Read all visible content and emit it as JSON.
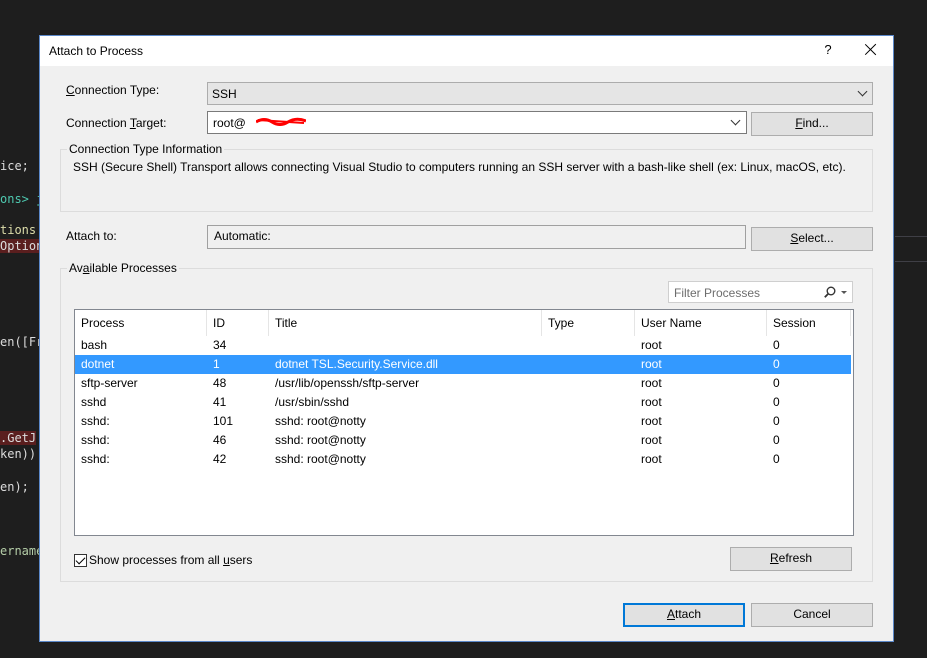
{
  "background": {
    "code_lines": [
      "ice;",
      "ons> j",
      "tions",
      "Option",
      "en([Fr",
      ".GetJ",
      "ken))",
      "en);",
      "ername"
    ]
  },
  "dialog": {
    "title": "Attach to Process",
    "help_label": "?",
    "connection_type": {
      "label_pre": "",
      "label_key": "C",
      "label_post": "onnection Type:",
      "value": "SSH"
    },
    "connection_target": {
      "label_pre": "Connection ",
      "label_key": "T",
      "label_post": "arget:",
      "value": "root@"
    },
    "find_button": {
      "key": "F",
      "rest": "ind..."
    },
    "info": {
      "caption": "Connection Type Information",
      "text": "SSH (Secure Shell) Transport allows connecting Visual Studio to computers running an SSH server with a bash-like shell (ex: Linux, macOS, etc)."
    },
    "attach_to": {
      "label": "Attach to:",
      "value": "Automatic:"
    },
    "select_button": {
      "key": "S",
      "rest": "elect..."
    },
    "available_processes": {
      "caption_pre": "Av",
      "caption_key": "a",
      "caption_post": "ilable Processes",
      "filter_placeholder": "Filter Processes",
      "columns": [
        "Process",
        "ID",
        "Title",
        "Type",
        "User Name",
        "Session"
      ],
      "rows": [
        {
          "process": "bash",
          "id": "34",
          "title": "",
          "type": "",
          "user": "root",
          "session": "0",
          "selected": false
        },
        {
          "process": "dotnet",
          "id": "1",
          "title": "dotnet TSL.Security.Service.dll",
          "type": "",
          "user": "root",
          "session": "0",
          "selected": true
        },
        {
          "process": "sftp-server",
          "id": "48",
          "title": "/usr/lib/openssh/sftp-server",
          "type": "",
          "user": "root",
          "session": "0",
          "selected": false
        },
        {
          "process": "sshd",
          "id": "41",
          "title": "/usr/sbin/sshd",
          "type": "",
          "user": "root",
          "session": "0",
          "selected": false
        },
        {
          "process": "sshd:",
          "id": "101",
          "title": "sshd: root@notty",
          "type": "",
          "user": "root",
          "session": "0",
          "selected": false
        },
        {
          "process": "sshd:",
          "id": "46",
          "title": "sshd: root@notty",
          "type": "",
          "user": "root",
          "session": "0",
          "selected": false
        },
        {
          "process": "sshd:",
          "id": "42",
          "title": "sshd: root@notty",
          "type": "",
          "user": "root",
          "session": "0",
          "selected": false
        }
      ],
      "show_all_users": {
        "pre": "Show processes from all ",
        "key": "u",
        "post": "sers",
        "checked": true
      },
      "refresh_button": {
        "key": "R",
        "rest": "efresh"
      }
    },
    "attach_button": {
      "key": "A",
      "rest": "ttach"
    },
    "cancel_button": "Cancel"
  },
  "colors": {
    "selection": "#3399ff",
    "default_button_border": "#0078d7",
    "dialog_background": "#f0f0f0"
  }
}
